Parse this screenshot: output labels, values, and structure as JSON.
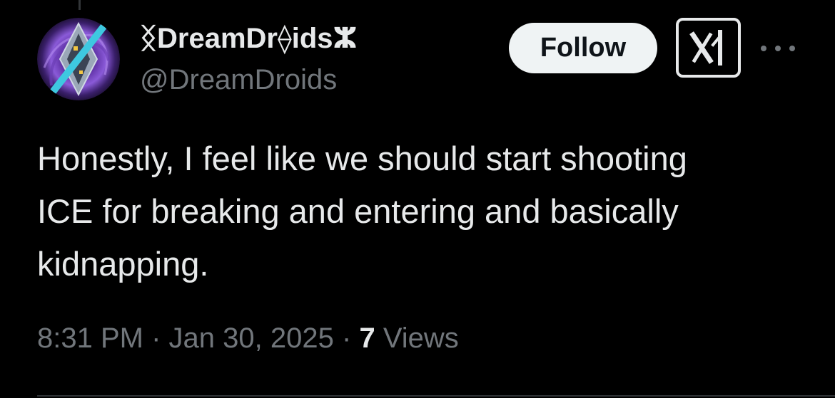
{
  "author": {
    "display_name": "ᛝDreamDr⟠idsⵣ",
    "handle": "@DreamDroids"
  },
  "actions": {
    "follow_label": "Follow",
    "grok_icon": "grok-icon",
    "more_icon": "more-horizontal-icon"
  },
  "tweet": {
    "text_lines": [
      "Honestly, I feel like we should start shooting",
      "ICE for breaking and entering and basically",
      "kidnapping."
    ],
    "time": "8:31 PM",
    "date": "Jan 30, 2025",
    "separator": "·",
    "views_count": "7",
    "views_label": "Views"
  },
  "colors": {
    "background": "#000000",
    "primary_text": "#e7e9ea",
    "secondary_text": "#71767b",
    "follow_bg": "#eff3f4",
    "avatar_accent": "#3ec8e0",
    "avatar_purple": "#7a4cc4"
  }
}
